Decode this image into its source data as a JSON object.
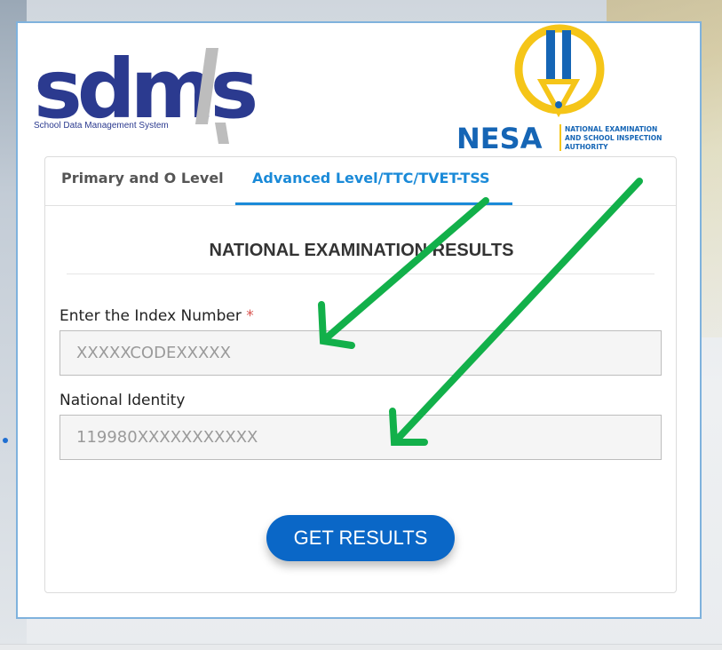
{
  "logos": {
    "sdms_wordmark": "sdms",
    "sdms_tagline": "School Data Management System",
    "nesa_wordmark": "NESA",
    "nesa_line1": "NATIONAL EXAMINATION",
    "nesa_line2": "AND SCHOOL INSPECTION",
    "nesa_line3": "AUTHORITY"
  },
  "tabs": [
    {
      "label": "Primary and O Level",
      "active": false
    },
    {
      "label": "Advanced Level/TTC/TVET-TSS",
      "active": true
    }
  ],
  "form": {
    "title": "NATIONAL EXAMINATION RESULTS",
    "index_label": "Enter the Index Number",
    "index_required_mark": "*",
    "index_placeholder": "XXXXXCODEXXXXX",
    "identity_label": "National Identity",
    "identity_placeholder": "119980XXXXXXXXXXX",
    "submit_label": "GET RESULTS"
  },
  "colors": {
    "accent": "#1a8ad8",
    "button": "#0a67c7",
    "sdms_blue": "#2b3a8f",
    "nesa_blue": "#1565b5",
    "nesa_yellow": "#f5c518",
    "arrow_green": "#12b04a"
  }
}
